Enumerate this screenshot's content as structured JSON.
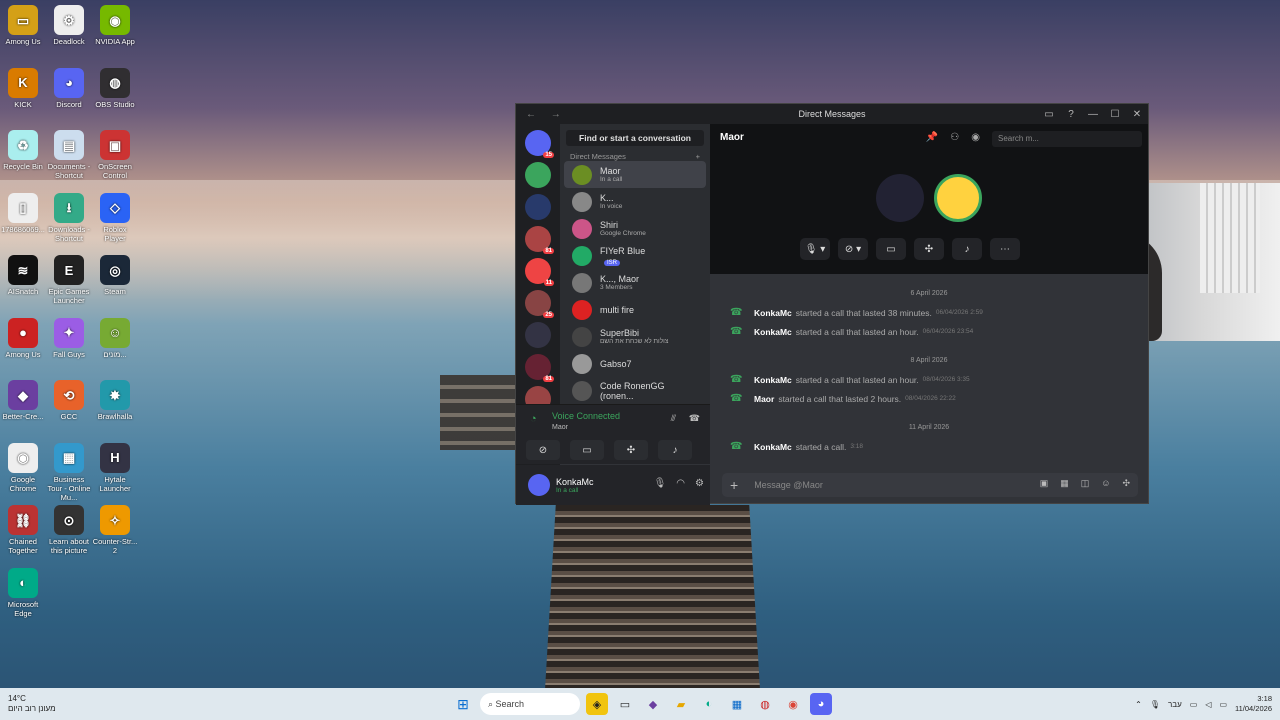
{
  "desktop": {
    "icons": [
      {
        "label": "Among Us",
        "x": 0,
        "color": "#d4a017",
        "glyph": "▭"
      },
      {
        "label": "Deadlock",
        "color": "#eee",
        "glyph": "⚙"
      },
      {
        "label": "NVIDIA App",
        "color": "#76b900",
        "glyph": "◉"
      },
      {
        "label": "KICK",
        "color": "#d97b00",
        "glyph": "K"
      },
      {
        "label": "Discord",
        "color": "#5865f2",
        "glyph": "◕"
      },
      {
        "label": "OBS Studio",
        "color": "#302e31",
        "glyph": "◍"
      },
      {
        "label": "Recycle Bin",
        "color": "#aee",
        "glyph": "♻"
      },
      {
        "label": "Documents - Shortcut",
        "color": "#cde",
        "glyph": "▤"
      },
      {
        "label": "OnScreen Control",
        "color": "#c33",
        "glyph": "▣"
      },
      {
        "label": "178686069...",
        "color": "#eee",
        "glyph": "▯"
      },
      {
        "label": "Downloads - Shortcut",
        "color": "#3a8",
        "glyph": "⭳"
      },
      {
        "label": "Roblox Player",
        "color": "#2a63f5",
        "glyph": "◇"
      },
      {
        "label": "AISnatch",
        "color": "#111",
        "glyph": "≋"
      },
      {
        "label": "Epic Games Launcher",
        "color": "#222",
        "glyph": "E"
      },
      {
        "label": "Steam",
        "color": "#1b2838",
        "glyph": "◎"
      },
      {
        "label": "Among Us",
        "color": "#c22",
        "glyph": "●"
      },
      {
        "label": "Fall Guys",
        "color": "#9b5de5",
        "glyph": "✦"
      },
      {
        "label": "מונים...",
        "color": "#7a3",
        "glyph": "☺"
      },
      {
        "label": "Better-Cre...",
        "color": "#6b3fa0",
        "glyph": "◆"
      },
      {
        "label": "GCC",
        "color": "#e8622a",
        "glyph": "⟲"
      },
      {
        "label": "Brawlhalla",
        "color": "#29a",
        "glyph": "✸"
      },
      {
        "label": "Google Chrome",
        "color": "#eee",
        "glyph": "◉"
      },
      {
        "label": "Business Tour - Online Mu...",
        "color": "#39c",
        "glyph": "▦"
      },
      {
        "label": "Hytale Launcher",
        "color": "#334",
        "glyph": "H"
      },
      {
        "label": "Chained Together",
        "color": "#b33",
        "glyph": "⛓"
      },
      {
        "label": "Learn about this picture",
        "color": "#333",
        "glyph": "⊙"
      },
      {
        "label": "Counter-Str... 2",
        "color": "#e90",
        "glyph": "✧"
      },
      {
        "label": "Microsoft Edge",
        "color": "#0a8",
        "glyph": "◐"
      }
    ]
  },
  "window": {
    "title": "Direct Messages",
    "nav": "← →"
  },
  "servers": [
    {
      "color": "#5865f2",
      "badge": "15"
    },
    {
      "color": "#3ba55d",
      "badge": ""
    },
    {
      "color": "#283a6b",
      "badge": ""
    },
    {
      "color": "#a44",
      "badge": "81"
    },
    {
      "color": "#e44",
      "badge": "11"
    },
    {
      "color": "#844",
      "badge": "25"
    },
    {
      "color": "#334",
      "badge": ""
    },
    {
      "color": "#623",
      "badge": "81"
    },
    {
      "color": "#944",
      "badge": "NEW"
    }
  ],
  "dms": {
    "find": "Find or start a conversation",
    "header": "Direct Messages",
    "add": "+",
    "items": [
      {
        "name": "Maor",
        "status": "In a call",
        "color": "#6b8e23",
        "active": true
      },
      {
        "name": "K...",
        "status": "In voice",
        "color": "#888"
      },
      {
        "name": "Shiri",
        "status": "Google Chrome",
        "color": "#c58"
      },
      {
        "name": "FIYeR Blue",
        "status": "",
        "badge": "ISR",
        "color": "#2a6"
      },
      {
        "name": "K..., Maor",
        "status": "3 Members",
        "color": "#777"
      },
      {
        "name": "multi fire",
        "status": "",
        "color": "#d22"
      },
      {
        "name": "SuperBibi",
        "status": "צולות לא שכחת את השם",
        "color": "#444"
      },
      {
        "name": "Gabso7",
        "status": "",
        "color": "#999"
      },
      {
        "name": "Code RonenGG (ronen...",
        "status": "",
        "color": "#555"
      }
    ]
  },
  "voice": {
    "title": "Voice Connected",
    "channel": "Maor"
  },
  "user": {
    "name": "KonkaMc",
    "status": "In a call"
  },
  "chat": {
    "header": "Maor",
    "search_placeholder": "Search m...",
    "composer_placeholder": "Message @Maor",
    "groups": [
      {
        "date": "6 April 2026",
        "messages": [
          {
            "who": "KonkaMc",
            "text": "started a call that lasted 38 minutes.",
            "ts": "06/04/2026 2:59"
          },
          {
            "who": "KonkaMc",
            "text": "started a call that lasted an hour.",
            "ts": "06/04/2026 23:54"
          }
        ]
      },
      {
        "date": "8 April 2026",
        "messages": [
          {
            "who": "KonkaMc",
            "text": "started a call that lasted an hour.",
            "ts": "08/04/2026 3:35"
          },
          {
            "who": "Maor",
            "text": "started a call that lasted 2 hours.",
            "ts": "08/04/2026 22:22"
          }
        ]
      },
      {
        "date": "11 April 2026",
        "messages": [
          {
            "who": "KonkaMc",
            "text": "started a call.",
            "ts": "3:18"
          }
        ]
      }
    ]
  },
  "taskbar": {
    "weather_temp": "14°C",
    "weather_desc": "מעונן רוב היום",
    "search": "Search",
    "lang": "עבר",
    "time": "3:18",
    "date": "11/04/2026"
  }
}
